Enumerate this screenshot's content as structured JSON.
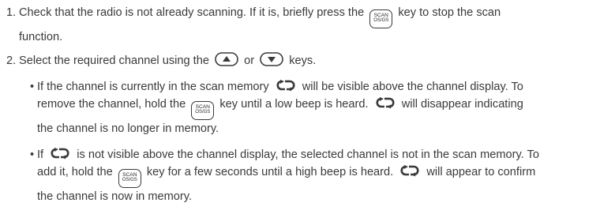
{
  "steps": [
    {
      "number": "1.",
      "text_a": "Check that the radio is not already scanning. If it is, briefly press the",
      "text_b": "key to stop the scan",
      "text_c": "function."
    },
    {
      "number": "2.",
      "text_a": "Select the required channel using the",
      "text_b": "or",
      "text_c": "keys."
    }
  ],
  "bullets": [
    {
      "bullet": "•",
      "line1_a": "If the channel is currently in the scan memory",
      "line1_b": "will be visible above the channel display. To",
      "line2_a": "remove the channel, hold the",
      "line2_b": "key until a low beep is heard.",
      "line2_c": "will disappear indicating",
      "line3": "the channel is no longer in memory."
    },
    {
      "bullet": "•",
      "line1_a": "If",
      "line1_b": "is not visible above the channel display, the selected channel is not in the scan memory. To",
      "line2_a": "add it, hold the",
      "line2_b": "key for a few seconds until a high beep is heard.",
      "line2_c": "will appear to confirm",
      "line3": "the channel is now in memory."
    }
  ],
  "scan_key": {
    "top": "SCAN",
    "bottom": "OS/GS"
  },
  "icons": {
    "scan_key": "scan-key-icon",
    "up_key": "up-arrow-key-icon",
    "down_key": "down-arrow-key-icon",
    "scan_memory_symbol": "scan-memory-icon"
  },
  "colors": {
    "text": "#3a3a3a"
  }
}
